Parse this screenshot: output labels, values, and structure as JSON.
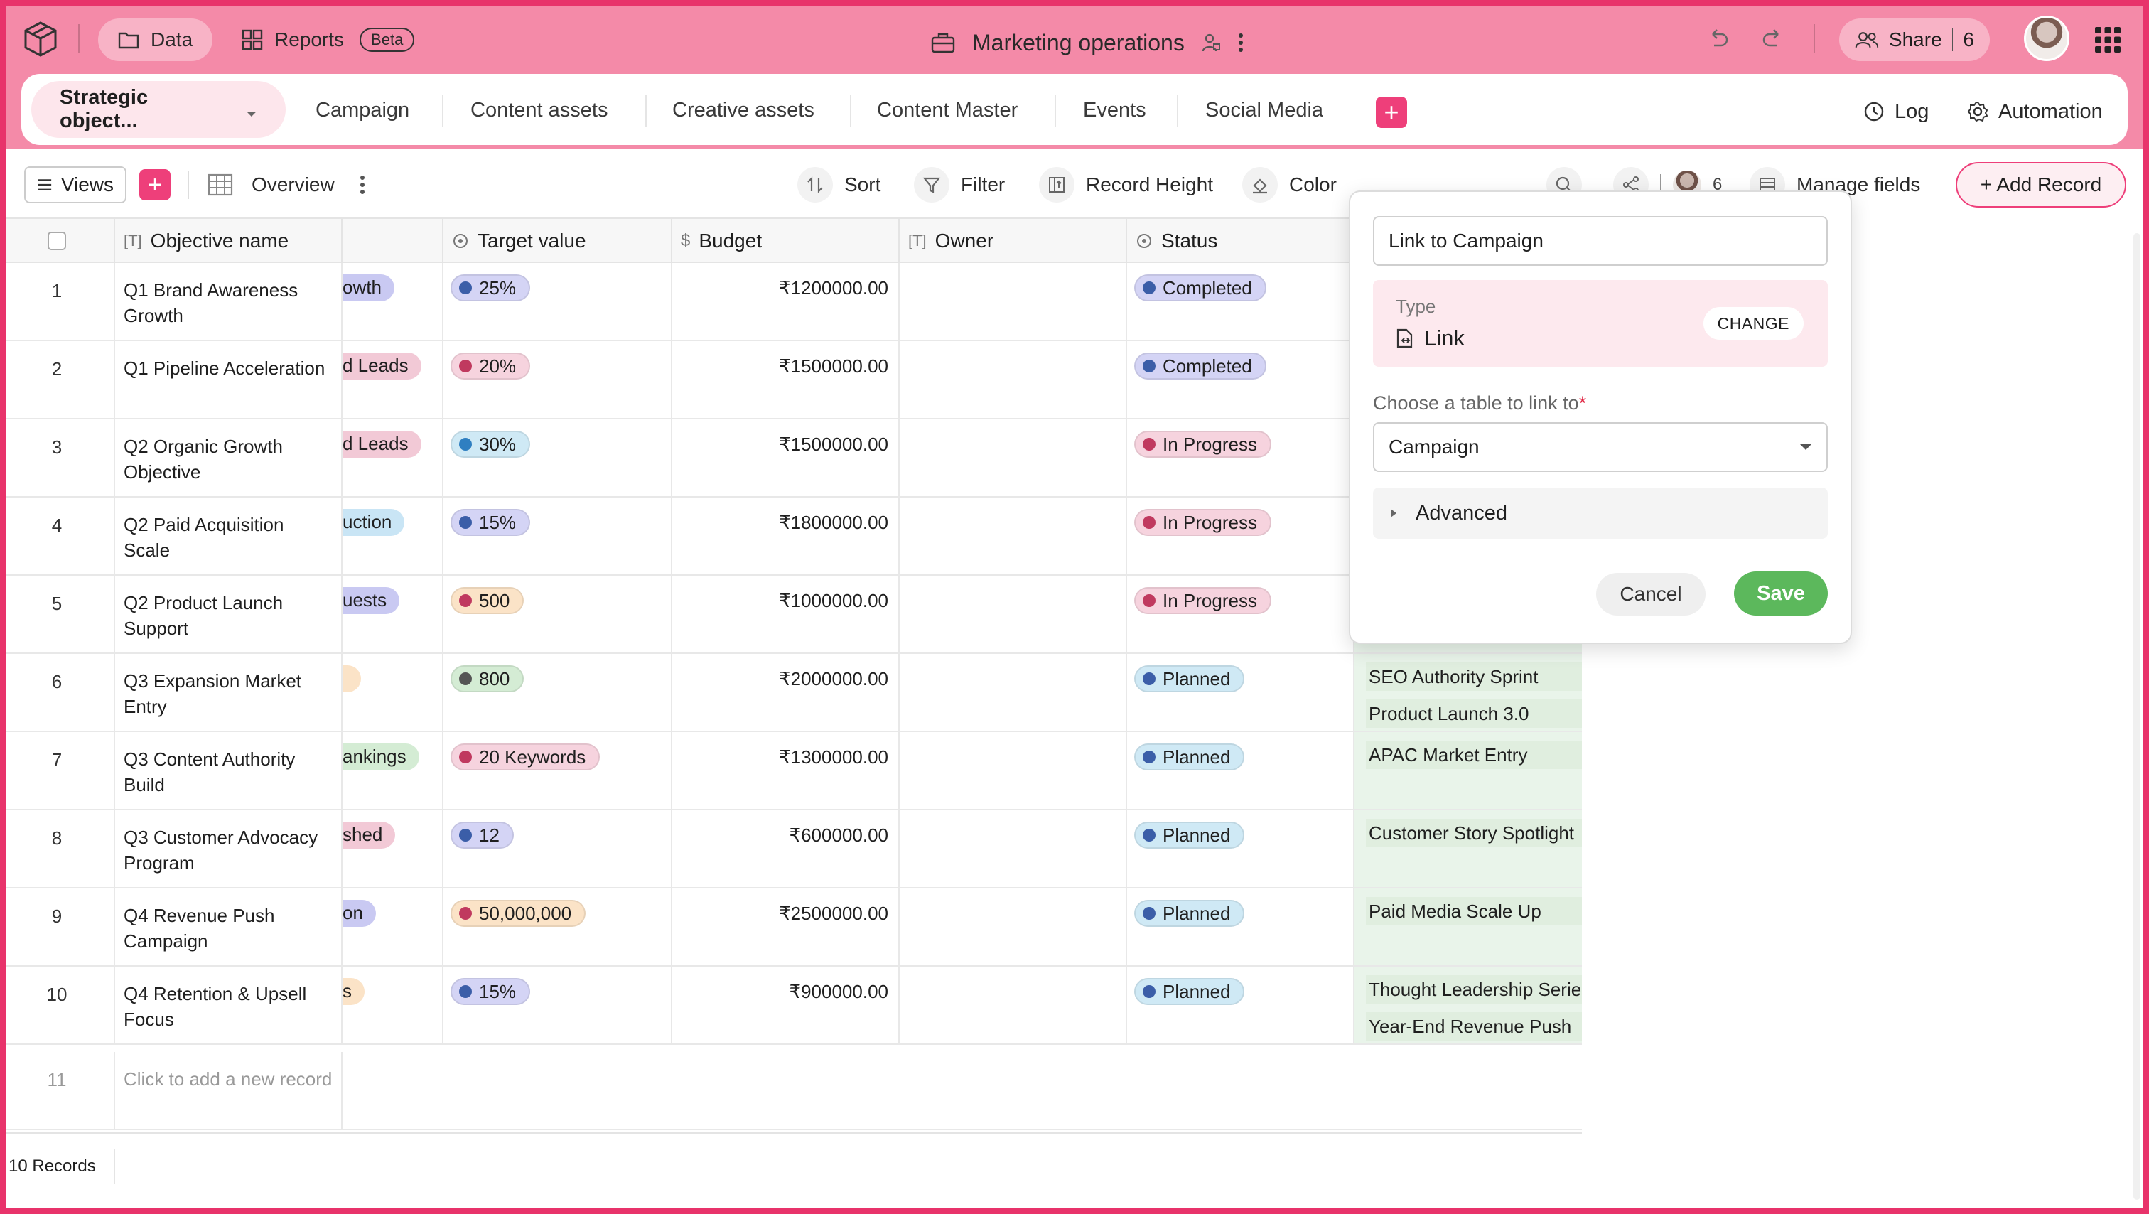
{
  "topbar": {
    "data_label": "Data",
    "reports_label": "Reports",
    "beta_badge": "Beta",
    "title": "Marketing operations",
    "share_label": "Share",
    "share_count": "6",
    "accent": "#f48aa8"
  },
  "tabs": {
    "active": "Strategic object...",
    "items": [
      "Campaign",
      "Content assets",
      "Creative assets",
      "Content Master",
      "Events",
      "Social Media"
    ],
    "add_label": "+",
    "log_label": "Log",
    "automation_label": "Automation"
  },
  "toolbar": {
    "views_label": "Views",
    "views_add": "+",
    "view_name": "Overview",
    "sort_label": "Sort",
    "filter_label": "Filter",
    "record_height_label": "Record Height",
    "color_label": "Color",
    "collaborators_count": "6",
    "manage_fields_label": "Manage fields",
    "add_record_label": "+ Add Record"
  },
  "table": {
    "headers": {
      "name": "Objective name",
      "target": "Target value",
      "budget": "Budget",
      "owner": "Owner",
      "status": "Status"
    },
    "rows": [
      {
        "num": "1",
        "name": "Q1 Brand Awareness Growth",
        "tag": "owth",
        "tag_color": "#c9c9f2",
        "target": "25%",
        "target_bg": "#d4d4f5",
        "target_dot": "#3b5ea8",
        "budget": "₹1200000.00",
        "status": "Completed",
        "status_bg": "#d4d4f5",
        "status_dot": "#3b5ea8",
        "links": []
      },
      {
        "num": "2",
        "name": "Q1 Pipeline Acceleration",
        "tag": "d Leads",
        "tag_color": "#f2c9d6",
        "target": "20%",
        "target_bg": "#f6d3de",
        "target_dot": "#c0395f",
        "budget": "₹1500000.00",
        "status": "Completed",
        "status_bg": "#d4d4f5",
        "status_dot": "#3b5ea8",
        "links": []
      },
      {
        "num": "3",
        "name": "Q2 Organic Growth Objective",
        "tag": "d Leads",
        "tag_color": "#f2c9d6",
        "target": "30%",
        "target_bg": "#cfe9f5",
        "target_dot": "#2f7fc1",
        "budget": "₹1500000.00",
        "status": "In Progress",
        "status_bg": "#f6d3de",
        "status_dot": "#c0395f",
        "links": []
      },
      {
        "num": "4",
        "name": "Q2 Paid Acquisition Scale",
        "tag": "uction",
        "tag_color": "#c9e5f5",
        "target": "15%",
        "target_bg": "#d4d4f5",
        "target_dot": "#3b5ea8",
        "budget": "₹1800000.00",
        "status": "In Progress",
        "status_bg": "#f6d3de",
        "status_dot": "#c0395f",
        "links": []
      },
      {
        "num": "5",
        "name": "Q2 Product Launch Support",
        "tag": "uests",
        "tag_color": "#c9c9f2",
        "target": "500",
        "target_bg": "#fbe3c7",
        "target_dot": "#c0395f",
        "budget": "₹1000000.00",
        "status": "In Progress",
        "status_bg": "#f6d3de",
        "status_dot": "#c0395f",
        "links": []
      },
      {
        "num": "6",
        "name": "Q3 Expansion Market Entry",
        "tag": "",
        "tag_color": "#fbe3c7",
        "target": "800",
        "target_bg": "#d4ecd4",
        "target_dot": "#555555",
        "budget": "₹2000000.00",
        "status": "Planned",
        "status_bg": "#cfe9f5",
        "status_dot": "#3b5ea8",
        "links": [
          "SEO Authority Sprint",
          "Product Launch 3.0"
        ]
      },
      {
        "num": "7",
        "name": "Q3 Content Authority Build",
        "tag": "ankings",
        "tag_color": "#d4ecd4",
        "target": "20 Keywords",
        "target_bg": "#f6d3de",
        "target_dot": "#c0395f",
        "budget": "₹1300000.00",
        "status": "Planned",
        "status_bg": "#cfe9f5",
        "status_dot": "#3b5ea8",
        "links": [
          "APAC Market Entry"
        ]
      },
      {
        "num": "8",
        "name": "Q3 Customer Advocacy Program",
        "tag": "shed",
        "tag_color": "#f2c9d6",
        "target": "12",
        "target_bg": "#d4d4f5",
        "target_dot": "#3b5ea8",
        "budget": "₹600000.00",
        "status": "Planned",
        "status_bg": "#cfe9f5",
        "status_dot": "#3b5ea8",
        "links": [
          "Customer Story Spotlight"
        ]
      },
      {
        "num": "9",
        "name": "Q4 Revenue Push Campaign",
        "tag": "on",
        "tag_color": "#c9c9f2",
        "target": "50,000,000",
        "target_bg": "#fbe3c7",
        "target_dot": "#c0395f",
        "budget": "₹2500000.00",
        "status": "Planned",
        "status_bg": "#cfe9f5",
        "status_dot": "#3b5ea8",
        "links": [
          "Paid Media Scale Up"
        ]
      },
      {
        "num": "10",
        "name": "Q4 Retention & Upsell Focus",
        "tag": "s",
        "tag_color": "#fbe3c7",
        "target": "15%",
        "target_bg": "#d4d4f5",
        "target_dot": "#3b5ea8",
        "budget": "₹900000.00",
        "status": "Planned",
        "status_bg": "#cfe9f5",
        "status_dot": "#3b5ea8",
        "links": [
          "Thought Leadership Serie",
          "Year-End Revenue Push"
        ]
      }
    ],
    "new_row_num": "11",
    "new_row_placeholder": "Click to add a new record",
    "group_count": "5",
    "records_count": "10 Records"
  },
  "popover": {
    "field_name_value": "Link to Campaign",
    "type_label": "Type",
    "type_value": "Link",
    "change_label": "CHANGE",
    "choose_label": "Choose a table to link to",
    "required_mark": "*",
    "selected_table": "Campaign",
    "advanced_label": "Advanced",
    "cancel_label": "Cancel",
    "save_label": "Save"
  }
}
